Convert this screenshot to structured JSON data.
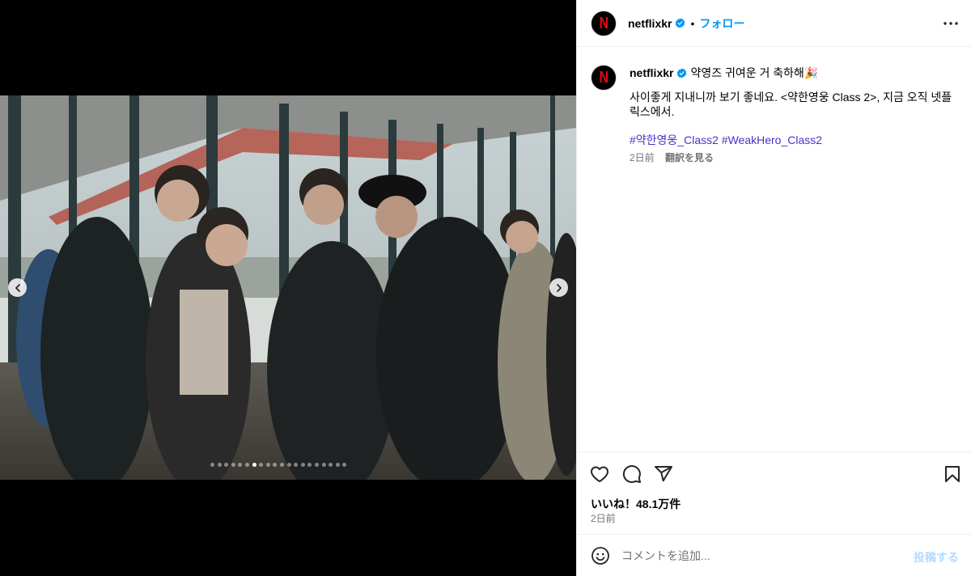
{
  "post": {
    "username": "netflixkr",
    "follow_label": "フォロー",
    "separator": "•",
    "avatar_letter": "N",
    "caption_line1": "약영즈 귀여운 거 축하해🎉",
    "caption_line2": "사이좋게 지내니까 보기 좋네요. <약한영웅 Class 2>, 지금 오직 넷플릭스에서.",
    "hashtags": [
      "#약한영웅_Class2",
      "#WeakHero_Class2"
    ],
    "caption_time": "2日前",
    "translate_label": "翻訳を見る",
    "likes_label": "いいね！48.1万件",
    "post_time": "2日前"
  },
  "media": {
    "slide_count": 20,
    "active_index": 6
  },
  "comment": {
    "placeholder": "コメントを追加...",
    "post_label": "投稿する"
  },
  "icons": {
    "verified": "verified-badge-icon",
    "more": "more-options-icon",
    "like": "heart-icon",
    "comment": "comment-icon",
    "share": "share-icon",
    "save": "bookmark-icon",
    "emoji": "emoji-icon",
    "prev": "chevron-left-icon",
    "next": "chevron-right-icon"
  },
  "colors": {
    "accent": "#0095f6",
    "netflix_red": "#e50914",
    "hashtag": "#4b30c8",
    "muted": "#737373"
  }
}
